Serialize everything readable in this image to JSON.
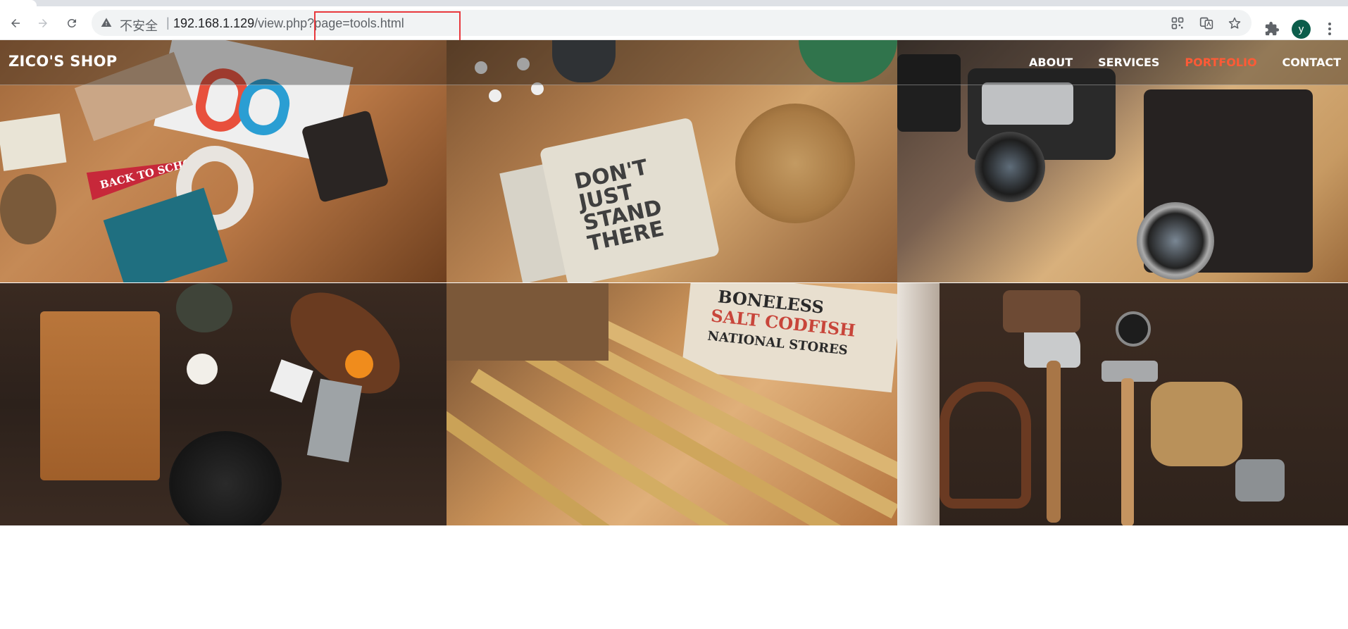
{
  "browser": {
    "security_text": "不安全",
    "url_host": "192.168.1.129",
    "url_path": "/view.php?page=tools.html",
    "avatar_letter": "y"
  },
  "site": {
    "brand": "ZICO'S SHOP",
    "nav": [
      {
        "label": "ABOUT"
      },
      {
        "label": "SERVICES"
      },
      {
        "label": "PORTFOLIO",
        "active": true
      },
      {
        "label": "CONTACT"
      }
    ],
    "accent_color": "#ff5a36"
  },
  "portfolio": {
    "tiles": [
      {
        "subject": "desk flatlay with typography items"
      },
      {
        "subject": "notebooks and coasters"
      },
      {
        "subject": "vintage cameras"
      },
      {
        "subject": "kitchen tools on wood"
      },
      {
        "subject": "wooden folding rulers"
      },
      {
        "subject": "old hand tools"
      }
    ],
    "tile_text": {
      "notebook": "DON'T JUST STAND THERE",
      "pennant": "BACK TO SCHOOL",
      "sign_line1": "BONELESS",
      "sign_line2": "SALT CODFISH",
      "sign_line3": "NATIONAL STORES"
    }
  }
}
